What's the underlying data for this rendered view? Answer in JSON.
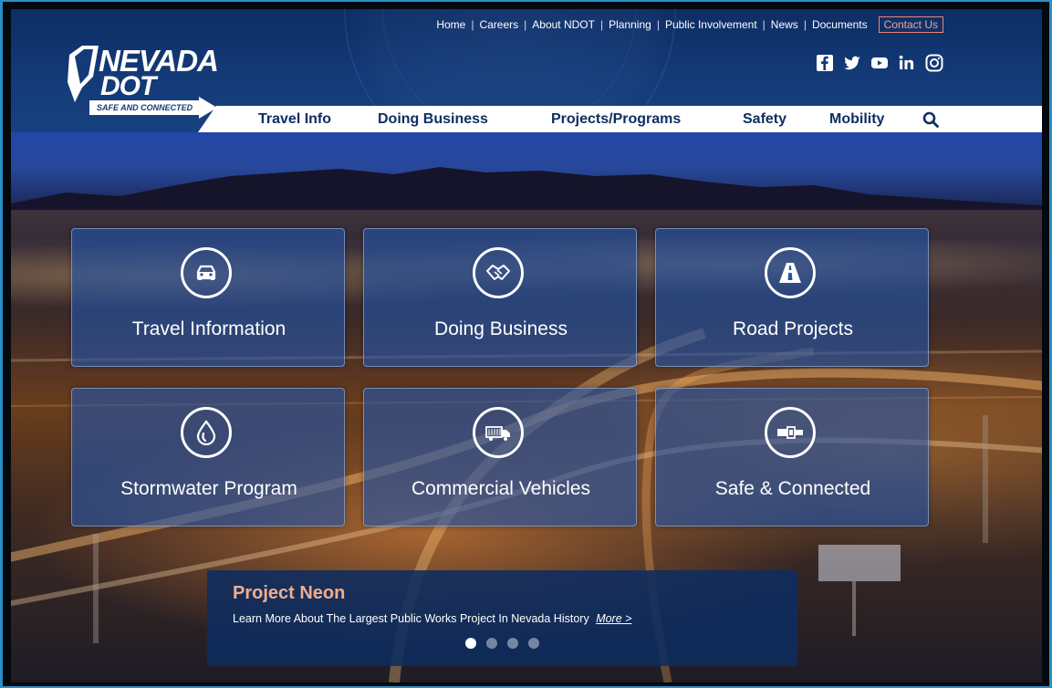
{
  "utility_nav": {
    "links": [
      "Home",
      "Careers",
      "About NDOT",
      "Planning",
      "Public Involvement",
      "News",
      "Documents"
    ],
    "contact": "Contact Us"
  },
  "logo": {
    "line1": "NEVADA",
    "line2": "DOT",
    "tagline": "SAFE AND CONNECTED"
  },
  "social_icons": [
    "facebook-icon",
    "twitter-icon",
    "youtube-icon",
    "linkedin-icon",
    "instagram-icon"
  ],
  "main_nav": {
    "items": [
      "Travel Info",
      "Doing Business",
      "Projects/Programs",
      "Safety",
      "Mobility"
    ]
  },
  "tiles": [
    {
      "label": "Travel Information",
      "icon": "car-icon"
    },
    {
      "label": "Doing Business",
      "icon": "handshake-icon"
    },
    {
      "label": "Road Projects",
      "icon": "road-icon"
    },
    {
      "label": "Stormwater Program",
      "icon": "water-drop-icon"
    },
    {
      "label": "Commercial Vehicles",
      "icon": "truck-icon"
    },
    {
      "label": "Safe & Connected",
      "icon": "seatbelt-icon"
    }
  ],
  "promo": {
    "title": "Project Neon",
    "description": "Learn More About The Largest Public Works Project In Nevada History",
    "more_label": "More >",
    "slides": 4,
    "active_slide": 1
  },
  "colors": {
    "header_blue": "#143a78",
    "nav_text": "#0e2f62",
    "promo_title": "#f2ad8d",
    "contact_border": "#e58a73"
  }
}
